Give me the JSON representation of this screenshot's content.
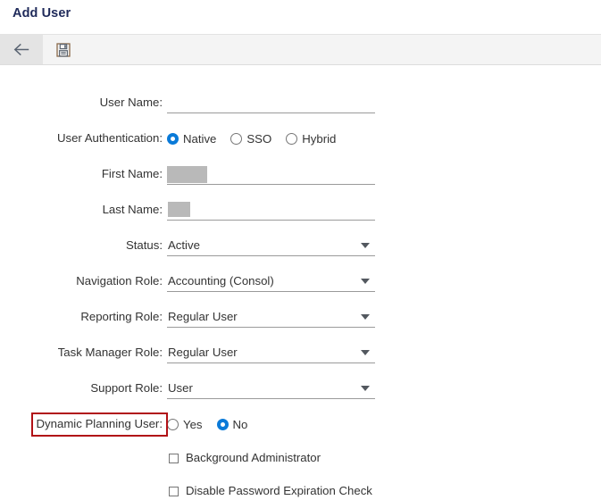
{
  "page": {
    "title": "Add User"
  },
  "toolbar": {
    "back_label": "",
    "back_icon": "arrow-left-icon",
    "save_label": "",
    "save_icon": "floppy-disk-save-icon"
  },
  "form": {
    "fields": [
      {
        "label": "User Name:",
        "type": "text",
        "value": ""
      },
      {
        "label": "User Authentication:",
        "type": "radio",
        "options": [
          "Native",
          "SSO",
          "Hybrid"
        ],
        "selected": "Native"
      },
      {
        "label": "First Name:",
        "type": "redacted",
        "value": ""
      },
      {
        "label": "Last Name:",
        "type": "redacted",
        "value": ""
      },
      {
        "label": "Status:",
        "type": "select",
        "value": "Active"
      },
      {
        "label": "Navigation Role:",
        "type": "select",
        "value": "Accounting (Consol)"
      },
      {
        "label": "Reporting Role:",
        "type": "select",
        "value": "Regular User"
      },
      {
        "label": "Task Manager Role:",
        "type": "select",
        "value": "Regular User"
      },
      {
        "label": "Support Role:",
        "type": "select",
        "value": "User"
      },
      {
        "label": "Dynamic Planning User:",
        "type": "radio",
        "options": [
          "Yes",
          "No"
        ],
        "selected": "No"
      }
    ],
    "checkboxes": [
      {
        "label": "Background Administrator",
        "checked": false
      },
      {
        "label": "Disable Password Expiration Check",
        "checked": false
      }
    ]
  },
  "annotation": {
    "target": "Dynamic Planning User:",
    "color": "#b11116"
  },
  "colors": {
    "title": "#1f2a5a",
    "accent_radio": "#0a7ad8",
    "toolbar_bg": "#f4f4f4",
    "underline": "#9a9a9a",
    "redaction": "#b9b9b9",
    "annotation": "#b11116"
  }
}
